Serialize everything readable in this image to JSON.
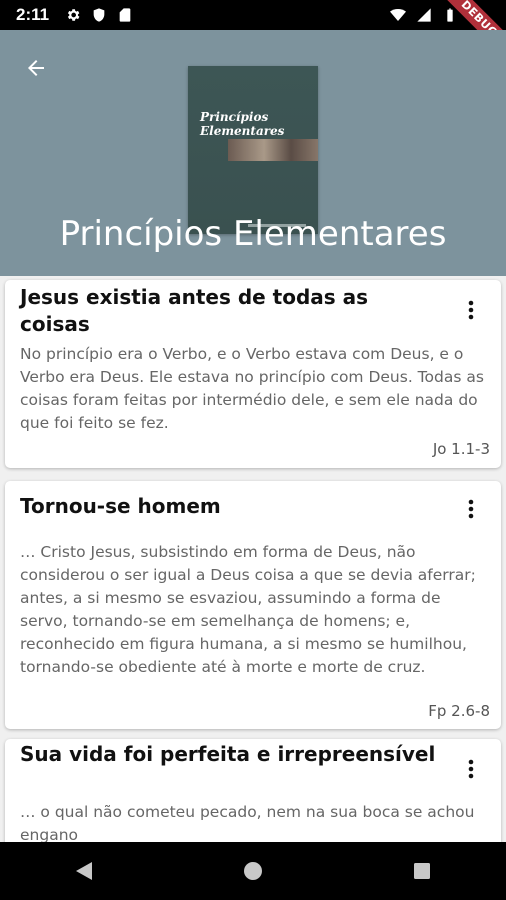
{
  "status_bar": {
    "time": "2:11",
    "debug_label": "DEBUG"
  },
  "header": {
    "title": "Princípios Elementares",
    "cover": {
      "title_line1": "Princípios",
      "title_line2": "Elementares"
    }
  },
  "cards": [
    {
      "title": "Jesus existia antes de todas as coisas",
      "text": "No princípio era o Verbo, e o Verbo estava com Deus, e o Verbo era Deus. Ele estava no princípio com Deus. Todas as coisas foram feitas por intermédio dele, e sem ele nada do que foi feito se fez.",
      "reference": "Jo 1.1-3"
    },
    {
      "title": "Tornou-se homem",
      "text": "… Cristo Jesus, subsistindo em forma de Deus, não considerou o ser igual a Deus coisa a que se devia aferrar; antes, a si mesmo se esvaziou, assumindo a forma de servo, tornando-se em semelhança de homens; e, reconhecido em figura humana, a si mesmo se humilhou, tornando-se obediente até à morte e morte de cruz.",
      "reference": "Fp 2.6-8"
    },
    {
      "title": "Sua vida foi perfeita e irrepreensível",
      "text": "… o qual não cometeu pecado, nem na sua boca se achou engano",
      "reference": ""
    }
  ],
  "colors": {
    "header_bg": "#7d939d",
    "debug_ribbon": "#b0303a"
  },
  "icons": [
    "settings-icon",
    "shield-icon",
    "sd-card-icon",
    "wifi-icon",
    "signal-icon",
    "battery-icon",
    "arrow-back-icon",
    "more-vert-icon",
    "nav-back-icon",
    "nav-home-icon",
    "nav-recents-icon"
  ]
}
